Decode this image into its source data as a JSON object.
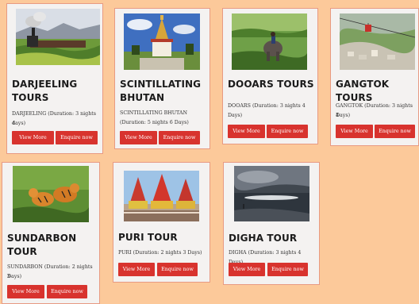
{
  "tours": [
    {
      "title_line1": "DARJEELING",
      "title_line2": "TOURS",
      "desc_line1": "DARJEELING (Duration: 3 nights 4",
      "desc_line2": "days)",
      "view_label": "View More",
      "enquire_label": "Enquire now",
      "image": "toy-train-tea-garden"
    },
    {
      "title_line1": "SCINTILLATING",
      "title_line2": "BHUTAN",
      "desc_line1": "SCINTILLATING BHUTAN",
      "desc_line2": "(Duration: 5 nights 6 Days)",
      "view_label": "View More",
      "enquire_label": "Enquire now",
      "image": "bhutan-stupa"
    },
    {
      "title_line1": "DOOARS TOURS",
      "title_line2": "",
      "desc_line1": "DOOARS (Duration: 3 nights 4",
      "desc_line2": "Days)",
      "view_label": "View More",
      "enquire_label": "Enquire now",
      "image": "elephant-safari"
    },
    {
      "title_line1": "GANGTOK TOURS",
      "title_line2": "",
      "desc_line1": "GANGTOK (Duration: 3 nights 4",
      "desc_line2": "Days)",
      "view_label": "View More",
      "enquire_label": "Enquire now",
      "image": "ropeway-cable-car"
    },
    {
      "title_line1": "SUNDARBON",
      "title_line2": "TOUR",
      "desc_line1": "SUNDARBON (Duration: 2 nights 3",
      "desc_line2": "Days)",
      "view_label": "View More",
      "enquire_label": "Enquire now",
      "image": "tigers"
    },
    {
      "title_line1": "PURI TOUR",
      "title_line2": "",
      "desc_line1": "PURI (Duration: 2 nights 3 Days)",
      "desc_line2": "",
      "view_label": "View More",
      "enquire_label": "Enquire now",
      "image": "rath-yatra-chariots"
    },
    {
      "title_line1": "DIGHA TOUR",
      "title_line2": "",
      "desc_line1": "DIGHA (Duration: 3 nights 4 Days)",
      "desc_line2": "",
      "view_label": "View More",
      "enquire_label": "Enquire now",
      "image": "sea-beach-sunset"
    }
  ],
  "colors": {
    "background": "#fcc99a",
    "card": "#f4f2f1",
    "button": "#d8332e",
    "title": "#1b1b1b"
  }
}
